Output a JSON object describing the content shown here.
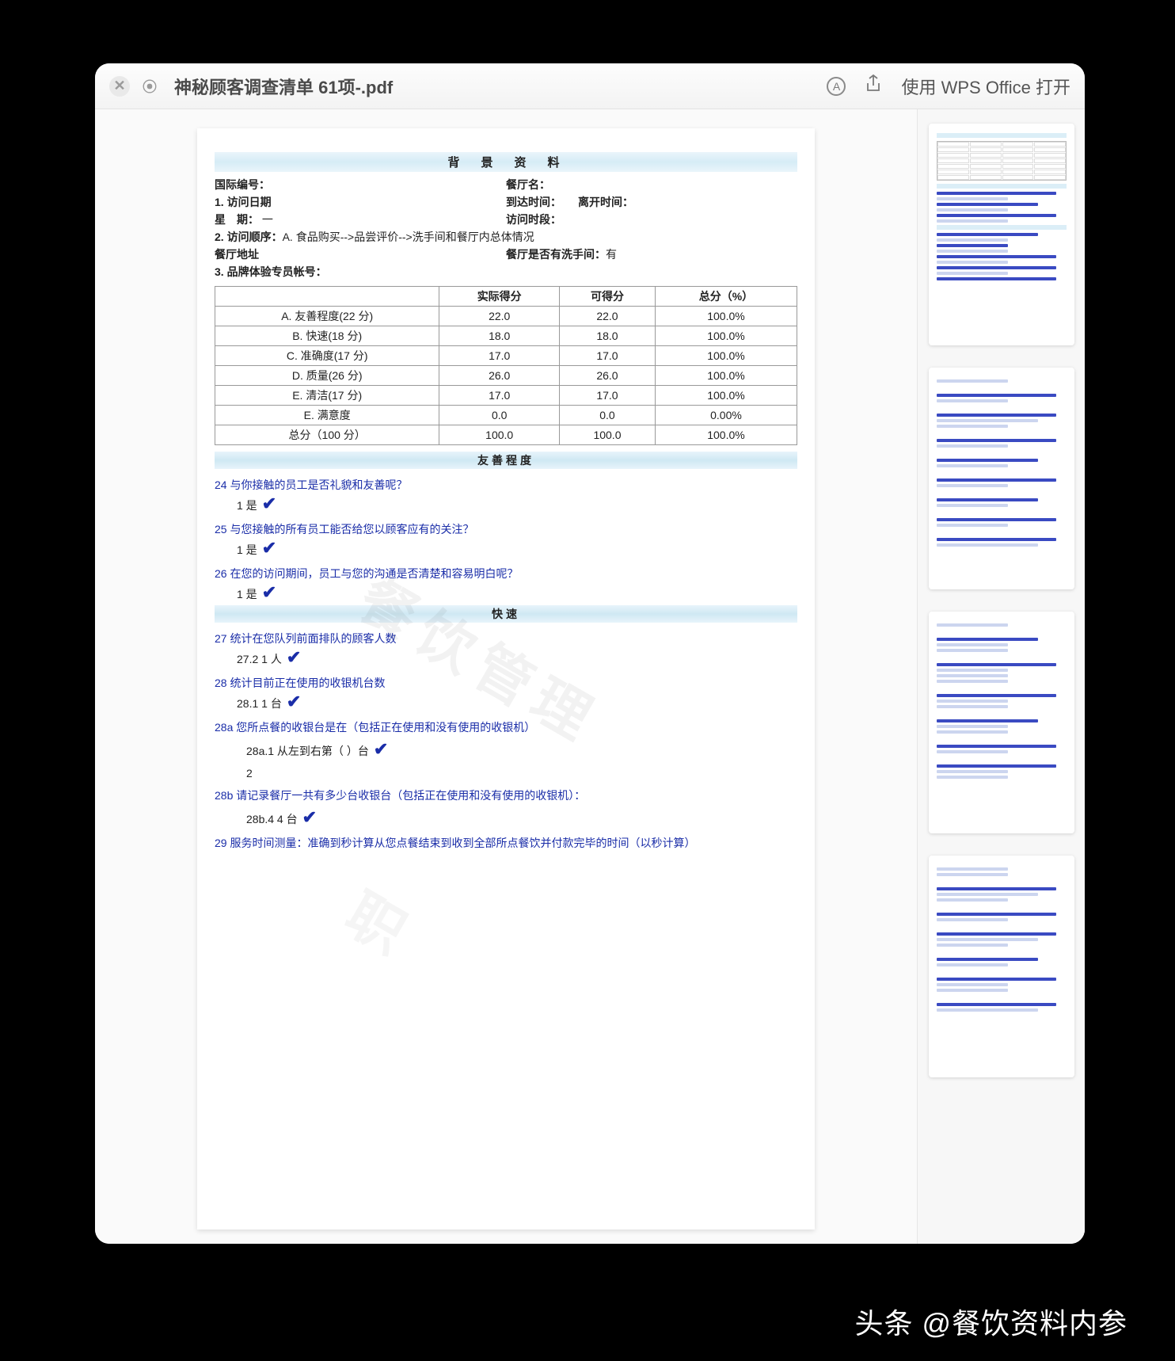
{
  "window": {
    "title": "神秘顾客调查清单 61项-.pdf",
    "open_with": "使用 WPS Office 打开"
  },
  "doc": {
    "section_title": "背　景　资　料",
    "fields": {
      "intl_id_label": "国际编号：",
      "restaurant_name_label": "餐厅名：",
      "visit_date_label": "1. 访问日期",
      "arrive_time_label": "到达时间：",
      "leave_time_label": "离开时间：",
      "week_label": "星　期：",
      "week_value": "一",
      "visit_period_label": "访问时段：",
      "visit_order_label": "2. 访问顺序：",
      "visit_order_value": "A. 食品购买-->品尝评价-->洗手间和餐厅内总体情况",
      "address_label": "餐厅地址",
      "has_wc_label": "餐厅是否有洗手间：",
      "has_wc_value": "有",
      "account_label": "3. 品牌体验专员帐号："
    },
    "table": {
      "headers": [
        "",
        "实际得分",
        "可得分",
        "总分（%）"
      ],
      "rows": [
        [
          "A. 友善程度(22 分)",
          "22.0",
          "22.0",
          "100.0%"
        ],
        [
          "B. 快速(18 分)",
          "18.0",
          "18.0",
          "100.0%"
        ],
        [
          "C. 准确度(17 分)",
          "17.0",
          "17.0",
          "100.0%"
        ],
        [
          "D. 质量(26 分)",
          "26.0",
          "26.0",
          "100.0%"
        ],
        [
          "E. 清洁(17 分)",
          "17.0",
          "17.0",
          "100.0%"
        ],
        [
          "E. 满意度",
          "0.0",
          "0.0",
          "0.00%"
        ],
        [
          "总分（100 分）",
          "100.0",
          "100.0",
          "100.0%"
        ]
      ]
    },
    "sections": {
      "friendly_title": "友善程度",
      "speed_title": "快速"
    },
    "questions": {
      "q24": "24  与你接触的员工是否礼貌和友善呢？",
      "a24": "1 是",
      "q25": "25  与您接触的所有员工能否给您以顾客应有的关注？",
      "a25": "1 是",
      "q26": "26  在您的访问期间，员工与您的沟通是否清楚和容易明白呢？",
      "a26": "1 是",
      "q27": "27  统计在您队列前面排队的顾客人数",
      "a27": "27.2 1 人",
      "q28": "28  统计目前正在使用的收银机台数",
      "a28": "28.1 1 台",
      "q28a": "28a  您所点餐的收银台是在（包括正在使用和没有使用的收银机）",
      "a28a": "28a.1 从左到右第（ ）台",
      "a28a_num": "2",
      "q28b": "28b  请记录餐厅一共有多少台收银台（包括正在使用和没有使用的收银机）：",
      "a28b": "28b.4 4 台",
      "q29": "29  服务时间测量：准确到秒计算从您点餐结束到收到全部所点餐饮并付款完毕的时间（以秒计算）"
    },
    "watermark": "餐饮管理",
    "watermark2": "职"
  },
  "attribution": "头条 @餐饮资料内参"
}
